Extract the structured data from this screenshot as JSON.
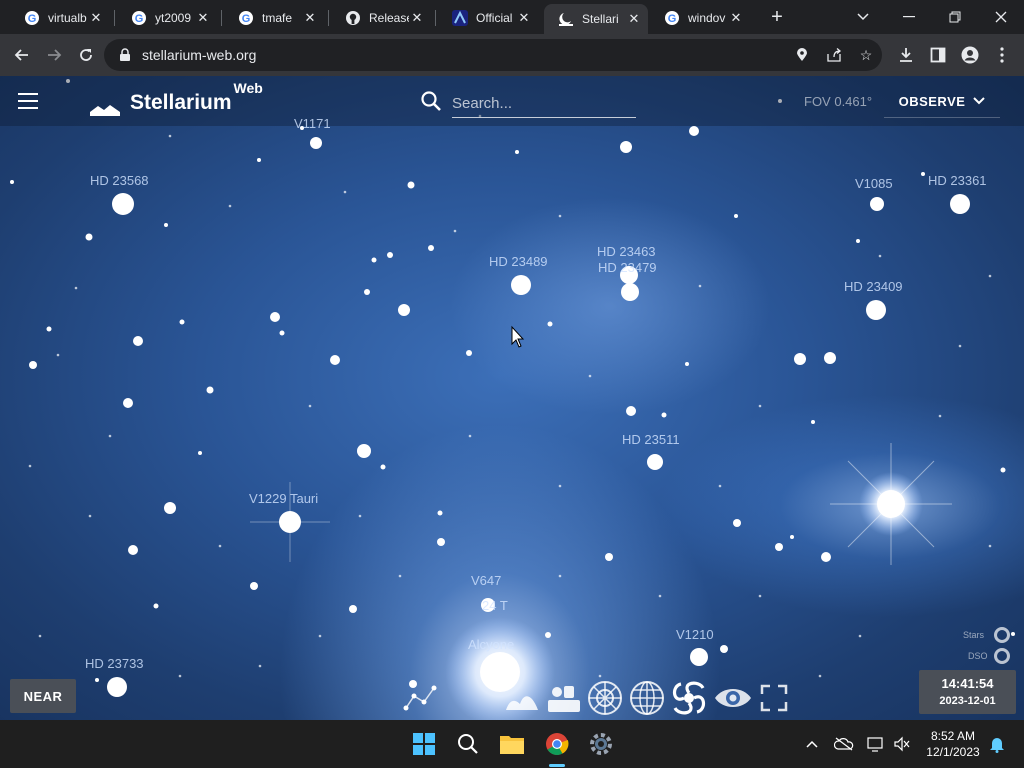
{
  "browser": {
    "tabs": [
      {
        "title": "virtualb",
        "icon": "google-icon",
        "active": false
      },
      {
        "title": "yt2009",
        "icon": "google-icon",
        "active": false
      },
      {
        "title": "tmafe",
        "icon": "google-icon",
        "active": false
      },
      {
        "title": "Release",
        "icon": "github-icon",
        "active": false
      },
      {
        "title": "Official",
        "icon": "official-site-icon",
        "active": false
      },
      {
        "title": "Stellari",
        "icon": "stellarium-icon",
        "active": true
      },
      {
        "title": "windov",
        "icon": "google-icon",
        "active": false
      }
    ],
    "new_tab_label": "+",
    "url": "stellarium-web.org"
  },
  "app": {
    "brand": "Stellarium",
    "brand_sup": "Web",
    "search_placeholder": "Search...",
    "fov": "FOV 0.461°",
    "observe_label": "OBSERVE"
  },
  "star_labels": [
    {
      "id": "v1171",
      "text": "V1171"
    },
    {
      "id": "hd23568",
      "text": "HD 23568"
    },
    {
      "id": "hd23489",
      "text": "HD 23489"
    },
    {
      "id": "hd23463",
      "text": "HD 23463"
    },
    {
      "id": "hd23479",
      "text": "HD 23479"
    },
    {
      "id": "v1085",
      "text": "V1085"
    },
    {
      "id": "hd23361",
      "text": "HD 23361"
    },
    {
      "id": "hd23409",
      "text": "HD 23409"
    },
    {
      "id": "hd23511",
      "text": "HD 23511"
    },
    {
      "id": "v1229",
      "text": "V1229 Tauri"
    },
    {
      "id": "v647",
      "text": "V647"
    },
    {
      "id": "v24tau",
      "text": "24 T"
    },
    {
      "id": "alcyone",
      "text": "Alcyone"
    },
    {
      "id": "v1210",
      "text": "V1210"
    },
    {
      "id": "hd23733",
      "text": "HD 23733"
    }
  ],
  "controls": {
    "near_label": "NEAR",
    "time": "14:41:54",
    "date": "2023-12-01",
    "stars_toggle": "Stars",
    "dso_toggle": "DSO",
    "bottom_icons": [
      "constellation-lines-icon",
      "landscape-icon",
      "atmosphere-icon",
      "azimuthal-grid-icon",
      "equatorial-grid-icon",
      "deep-sky-objects-icon",
      "night-mode-eye-icon",
      "fullscreen-icon"
    ]
  },
  "taskbar": {
    "apps": [
      "windows-start-icon",
      "search-icon",
      "file-explorer-icon",
      "chrome-icon",
      "settings-icon"
    ],
    "clock_time": "8:52 AM",
    "clock_date": "12/1/2023"
  },
  "colors": {
    "sky_dark": "#16305a",
    "sky_mid": "#2a5596",
    "chrome_bg": "#202124",
    "toolbar_bg": "#35363a",
    "taskbar_bg": "#1f1f1f",
    "panel_bg": "#4a4f57"
  }
}
